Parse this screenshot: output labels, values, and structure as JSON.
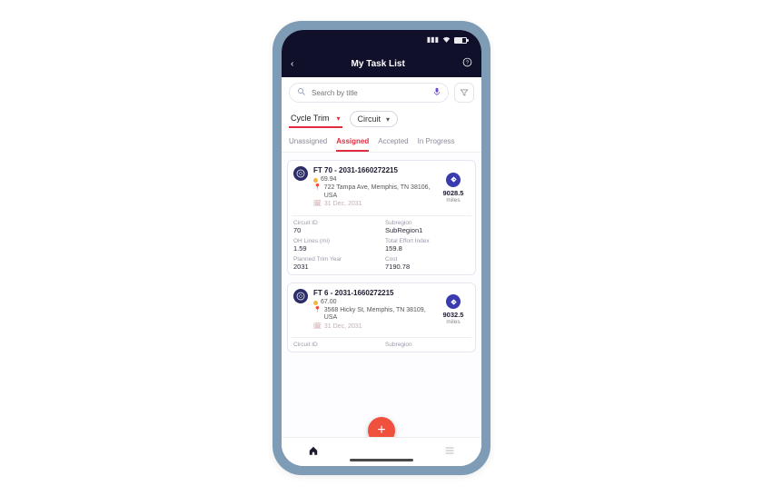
{
  "header": {
    "title": "My Task List"
  },
  "search": {
    "placeholder": "Search by title"
  },
  "filters": {
    "cycle_label": "Cycle Trim",
    "circuit_label": "Circuit"
  },
  "tabs": {
    "unassigned": "Unassigned",
    "assigned": "Assigned",
    "accepted": "Accepted",
    "in_progress": "In Progress"
  },
  "tasks": [
    {
      "title": "FT 70 - 2031-1660272215",
      "score": "69.94",
      "address": "722 Tampa Ave, Memphis, TN 38106, USA",
      "due": "31 Dec, 2031",
      "distance": "9028.5",
      "distance_unit": "miles",
      "details": {
        "circuit_id_lbl": "Circuit ID",
        "circuit_id_val": "70",
        "subregion_lbl": "Subregion",
        "subregion_val": "SubRegion1",
        "oh_lbl": "OH Lines (mi)",
        "oh_val": "1.59",
        "effort_lbl": "Total Effort Index",
        "effort_val": "159.8",
        "year_lbl": "Planned Trim Year",
        "year_val": "2031",
        "cost_lbl": "Cost",
        "cost_val": "7190.78"
      }
    },
    {
      "title": "FT 6 - 2031-1660272215",
      "score": "67.00",
      "address": "3568 Hicky St, Memphis, TN 38109, USA",
      "due": "31 Dec, 2031",
      "distance": "9032.5",
      "distance_unit": "miles",
      "details": {
        "circuit_id_lbl": "Circuit ID",
        "subregion_lbl": "Subregion"
      }
    }
  ],
  "icons": {
    "back": "‹",
    "help": "?",
    "plus": "+"
  }
}
